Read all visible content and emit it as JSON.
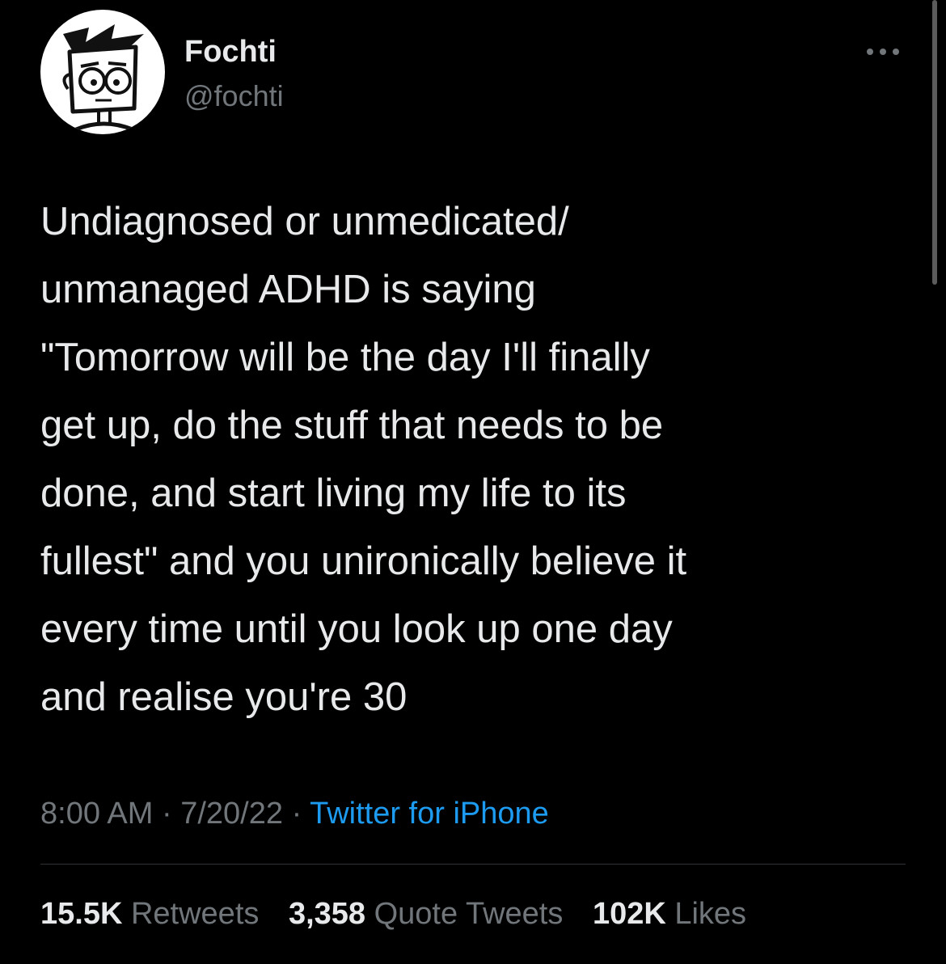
{
  "tweet": {
    "author": {
      "display_name": "Fochti",
      "handle": "@fochti",
      "avatar_icon": "cartoon-face-avatar"
    },
    "more_icon": "more-horizontal-icon",
    "text": "Undiagnosed or unmedicated/\nunmanaged ADHD is saying\n\"Tomorrow will be the day I'll finally\nget up, do the stuff that needs to be\ndone, and start living my life to its\nfullest\" and you unironically believe it\nevery time until you look up one day\nand realise you're 30",
    "time": "8:00 AM",
    "separator": "·",
    "date": "7/20/22",
    "source": "Twitter for iPhone",
    "stats": {
      "retweets_count": "15.5K",
      "retweets_label": "Retweets",
      "quotes_count": "3,358",
      "quotes_label": "Quote Tweets",
      "likes_count": "102K",
      "likes_label": "Likes"
    }
  },
  "colors": {
    "background": "#000000",
    "primary_text": "#e7e9ea",
    "secondary_text": "#71767b",
    "link": "#1d9bf0",
    "divider": "#2f3336"
  }
}
